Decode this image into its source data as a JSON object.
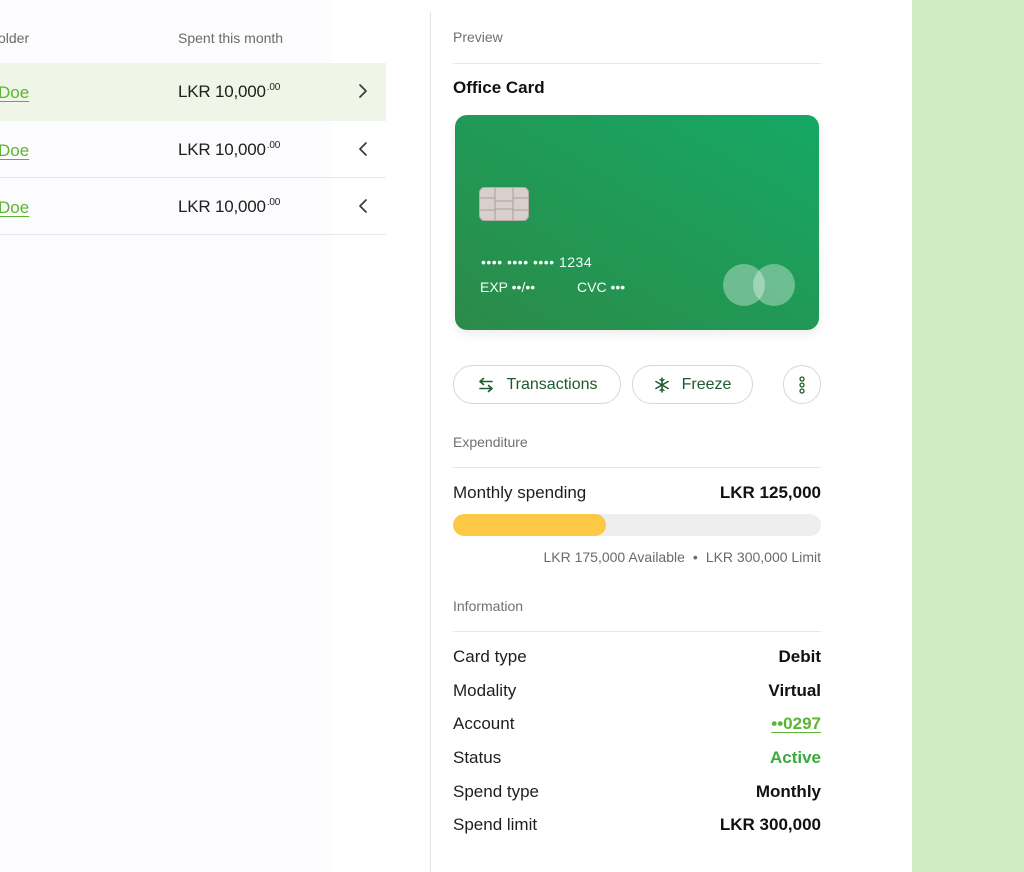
{
  "table": {
    "headers": {
      "holder": "older",
      "spent": "Spent  this month"
    },
    "rows": [
      {
        "holder": "Doe",
        "amount": "LKR 10,000",
        "cents": ".00",
        "chevron": ">"
      },
      {
        "holder": "Doe",
        "amount": "LKR 10,000",
        "cents": ".00",
        "chevron": "<"
      },
      {
        "holder": "Doe",
        "amount": "LKR 10,000",
        "cents": ".00",
        "chevron": "<"
      }
    ]
  },
  "preview": {
    "section_label": "Preview",
    "card_title": "Office Card",
    "card": {
      "number": "•••• •••• •••• 1234",
      "exp_label": "EXP",
      "exp_value": "••/••",
      "cvc_label": "CVC",
      "cvc_value": "•••",
      "brand_icon": "mastercard-icon"
    },
    "actions": {
      "transactions_label": "Transactions",
      "transactions_icon": "arrows-swap-icon",
      "freeze_label": "Freeze",
      "freeze_icon": "snowflake-icon",
      "more_icon": "vertical-dots-icon"
    }
  },
  "expenditure": {
    "section_label": "Expenditure",
    "monthly_label": "Monthly spending",
    "monthly_value": "LKR 125,000",
    "progress_fraction": 0.4167,
    "available_text": "LKR 175,000 Available",
    "separator": "•",
    "limit_text": "LKR 300,000 Limit",
    "bar_color": "#fdc844"
  },
  "information": {
    "section_label": "Information",
    "rows": [
      {
        "key": "Card type",
        "value": "Debit"
      },
      {
        "key": "Modality",
        "value": "Virtual"
      },
      {
        "key": "Account",
        "value": "••0297"
      },
      {
        "key": "Status",
        "value": "Active"
      },
      {
        "key": "Spend type",
        "value": "Monthly"
      },
      {
        "key": "Spend limit",
        "value": "LKR 300,000"
      }
    ]
  },
  "colors": {
    "accent_green": "#5cb531",
    "card_green": "#1f9b57",
    "active_green": "#3aaa3e",
    "right_backdrop": "#cfecc2"
  }
}
